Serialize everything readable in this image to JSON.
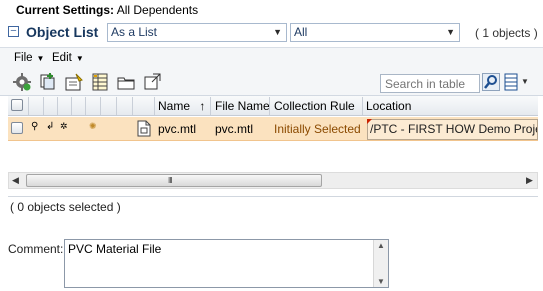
{
  "settings": {
    "label": "Current Settings:",
    "value": "All Dependents"
  },
  "object_list": {
    "title": "Object List",
    "view_select": "As a List",
    "filter_select": "All",
    "count": "( 1 objects )"
  },
  "menus": [
    {
      "label": "File"
    },
    {
      "label": "Edit"
    }
  ],
  "toolbar": {
    "search_placeholder": "Search in table",
    "icons": [
      "settings-gear-icon",
      "add-object-icon",
      "edit-properties-icon",
      "table-view-icon",
      "folder-icon",
      "new-window-icon",
      "search-icon",
      "column-chooser-icon"
    ]
  },
  "table": {
    "columns": {
      "name": "Name",
      "name_sort": "↑",
      "file_name": "File Name",
      "collection_rule": "Collection Rule",
      "location": "Location"
    },
    "rows": [
      {
        "name": "pvc.mtl",
        "file_name": "pvc.mtl",
        "collection_rule": "Initially Selected",
        "location": "/PTC - FIRST HOW Demo Project/C"
      }
    ],
    "status": "( 0 objects selected )",
    "scroll_grip": "III"
  },
  "comment": {
    "label": "Comment:",
    "value": "PVC Material File"
  },
  "colors": {
    "selected_row": "#fbe2bf",
    "title_blue": "#17375e",
    "rule_text": "#8b4a00"
  }
}
